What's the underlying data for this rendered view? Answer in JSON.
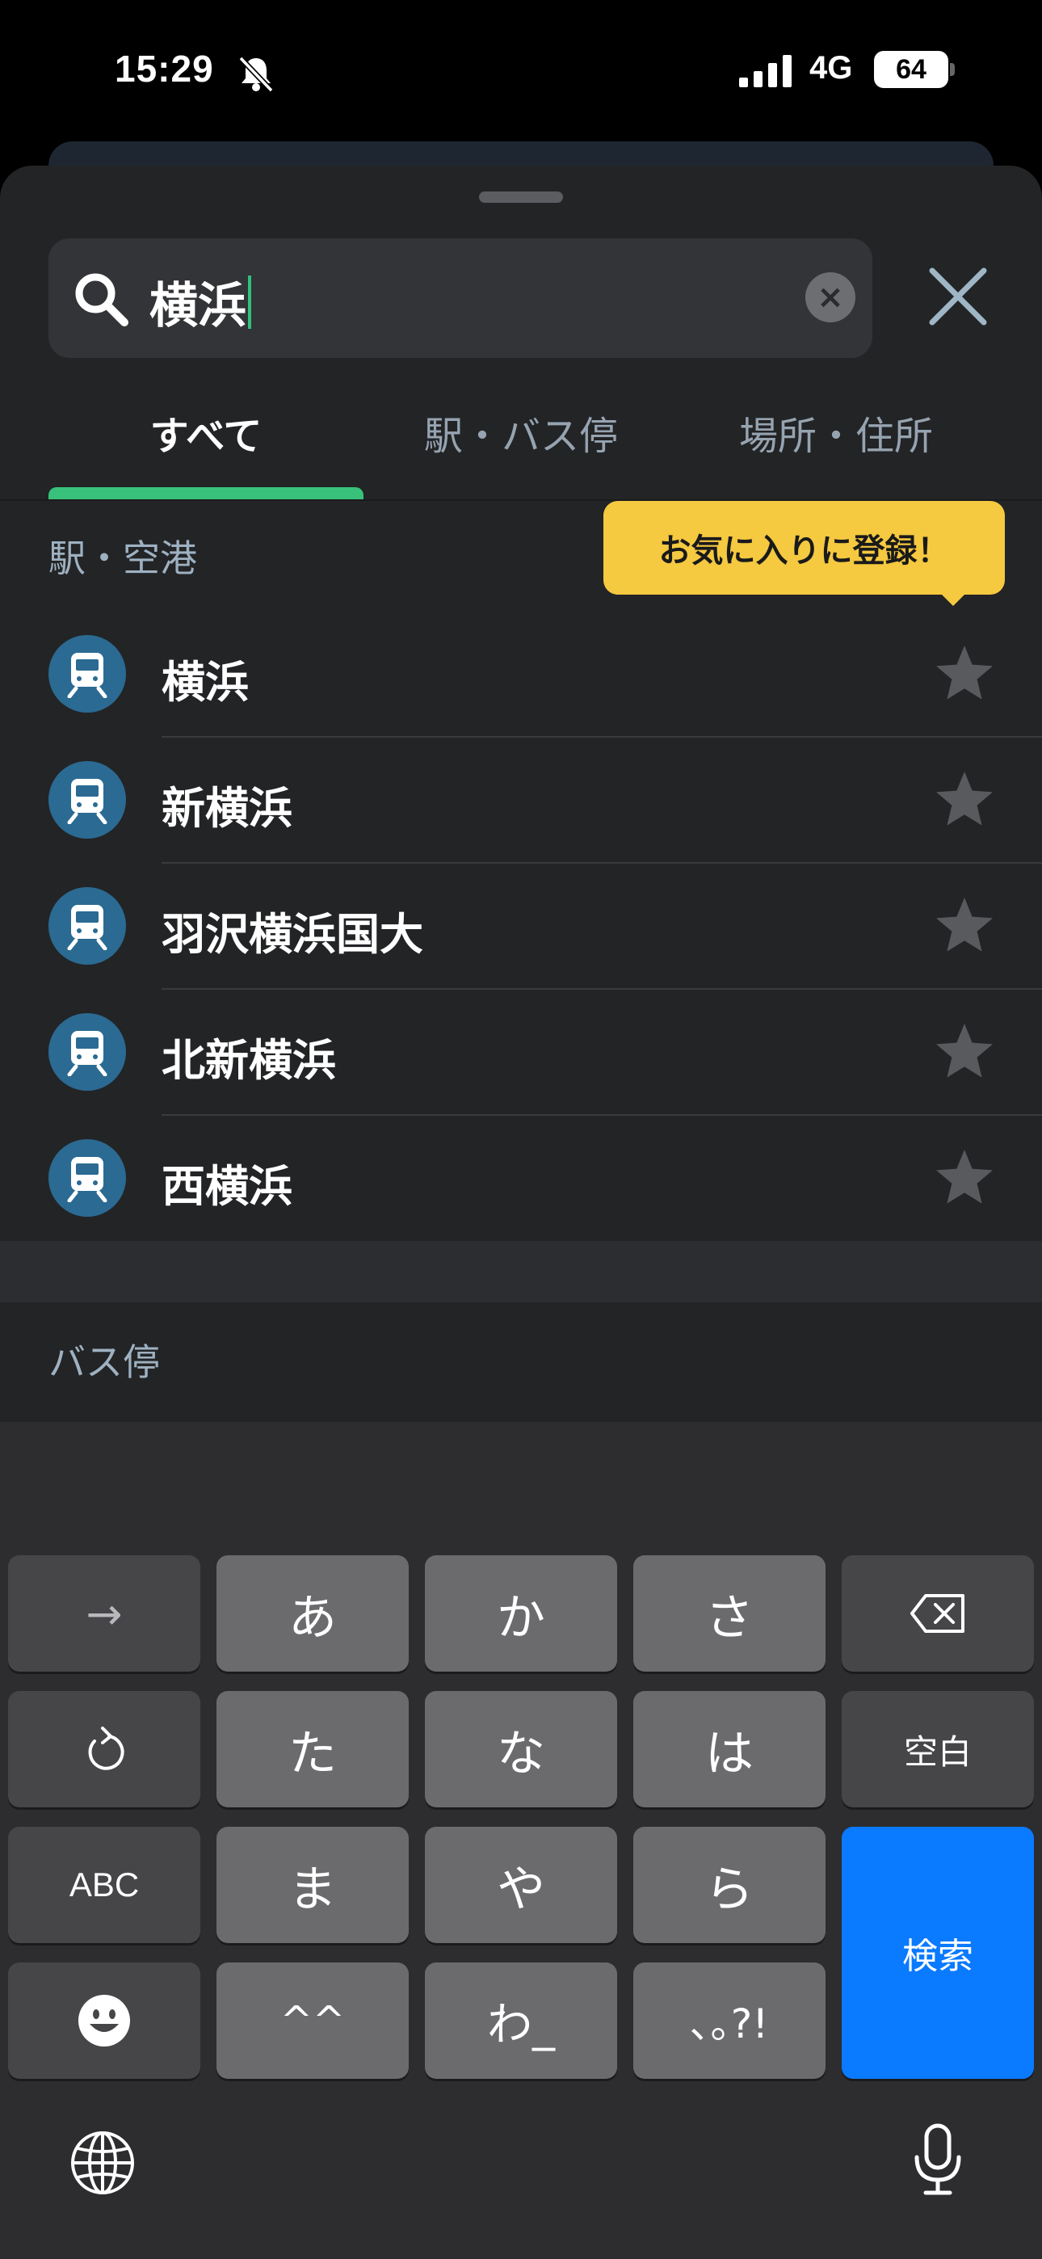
{
  "status_bar": {
    "time": "15:29",
    "network": "4G",
    "battery": "64"
  },
  "search": {
    "query": "横浜"
  },
  "tabs": [
    {
      "label": "すべて"
    },
    {
      "label": "駅・バス停"
    },
    {
      "label": "場所・住所"
    }
  ],
  "tooltip": {
    "text": "お気に入りに登録！"
  },
  "sections": {
    "stations_title": "駅・空港",
    "bus_title": "バス停"
  },
  "stations": [
    {
      "name": "横浜"
    },
    {
      "name": "新横浜"
    },
    {
      "name": "羽沢横浜国大"
    },
    {
      "name": "北新横浜"
    },
    {
      "name": "西横浜"
    }
  ],
  "keyboard": {
    "row1": [
      "→",
      "あ",
      "か",
      "さ"
    ],
    "row2": [
      "た",
      "な",
      "は",
      "空白"
    ],
    "row3": [
      "ABC",
      "ま",
      "や",
      "ら"
    ],
    "row4": [
      "^^",
      "わ_",
      "､｡?!"
    ],
    "search_key": "検索"
  },
  "colors": {
    "accent_green": "#38c17a",
    "tooltip_yellow": "#f5c940",
    "station_icon_blue": "#2b6a92",
    "search_key_blue": "#0a7aff"
  },
  "icons": {
    "station": "train-icon",
    "favorite": "star-icon",
    "globe": "globe-icon",
    "mic": "mic-icon"
  }
}
